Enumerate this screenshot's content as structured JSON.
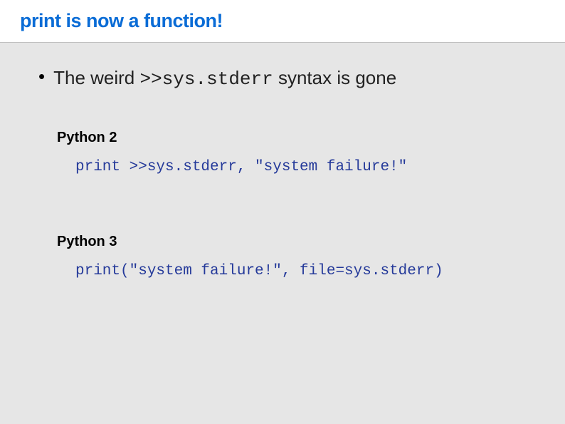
{
  "header": {
    "title": "print is now a function!"
  },
  "bullet": {
    "prefix": "The weird ",
    "code": ">>sys.stderr",
    "suffix": " syntax is gone"
  },
  "examples": [
    {
      "label": "Python 2",
      "code": "print >>sys.stderr, \"system failure!\""
    },
    {
      "label": "Python 3",
      "code": "print(\"system failure!\", file=sys.stderr)"
    }
  ]
}
